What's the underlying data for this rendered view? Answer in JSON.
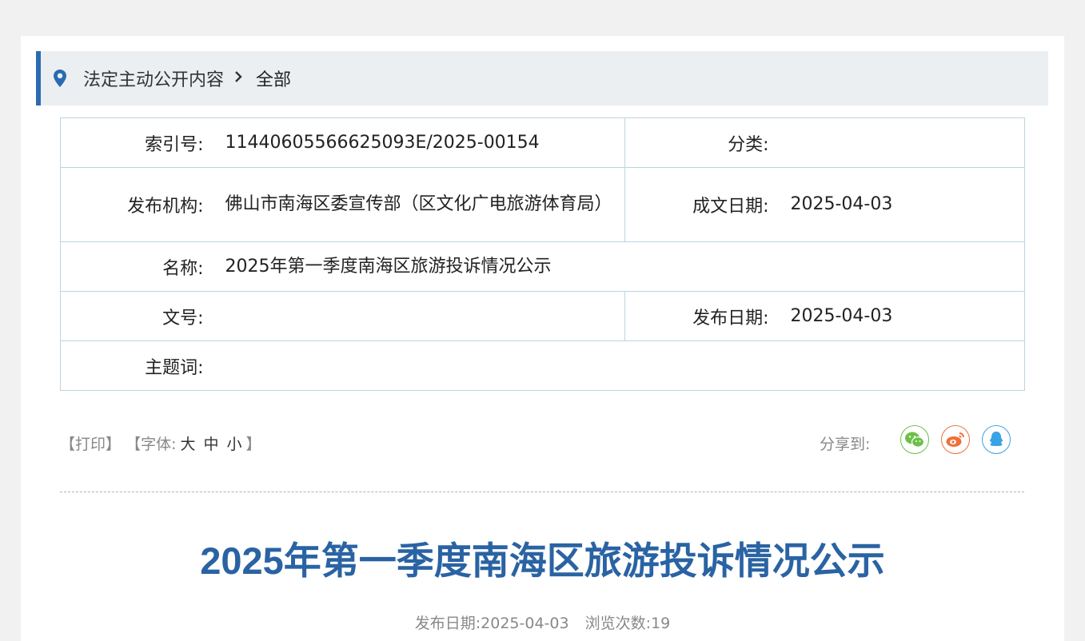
{
  "breadcrumb": {
    "section": "法定主动公开内容",
    "separator": "›",
    "current": "全部"
  },
  "meta": {
    "index_label": "索引号:",
    "index_value": "11440605566625093E/2025-00154",
    "category_label": "分类:",
    "category_value": "",
    "publisher_label": "发布机构:",
    "publisher_value": "佛山市南海区委宣传部（区文化广电旅游体育局）",
    "written_date_label": "成文日期:",
    "written_date_value": "2025-04-03",
    "name_label": "名称:",
    "name_value": "2025年第一季度南海区旅游投诉情况公示",
    "doc_no_label": "文号:",
    "doc_no_value": "",
    "publish_date_label": "发布日期:",
    "publish_date_value": "2025-04-03",
    "keywords_label": "主题词:",
    "keywords_value": ""
  },
  "tools": {
    "print": "【打印】",
    "font_prefix": "【字体:",
    "font_large": "大",
    "font_medium": "中",
    "font_small": "小",
    "font_suffix": "】",
    "share_label": "分享到:"
  },
  "share_icons": [
    {
      "name": "wechat-icon",
      "color": "#6cc04a"
    },
    {
      "name": "weibo-icon",
      "color": "#f0703a"
    },
    {
      "name": "qq-icon",
      "color": "#3aa3e3"
    }
  ],
  "article": {
    "title": "2025年第一季度南海区旅游投诉情况公示",
    "date_label": "发布日期:",
    "date_value": "2025-04-03",
    "views_label": "浏览次数:",
    "views_value": "19"
  }
}
